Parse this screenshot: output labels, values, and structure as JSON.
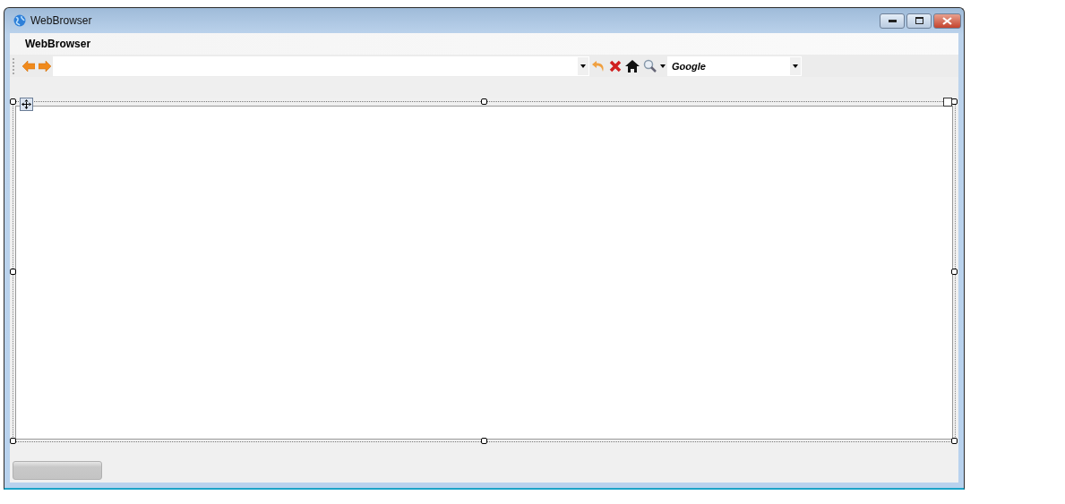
{
  "window": {
    "title": "WebBrowser"
  },
  "header": {
    "title": "WebBrowser"
  },
  "toolbar": {
    "search_engine": {
      "value": "Google"
    }
  },
  "progress_bar": {
    "level": 0
  }
}
